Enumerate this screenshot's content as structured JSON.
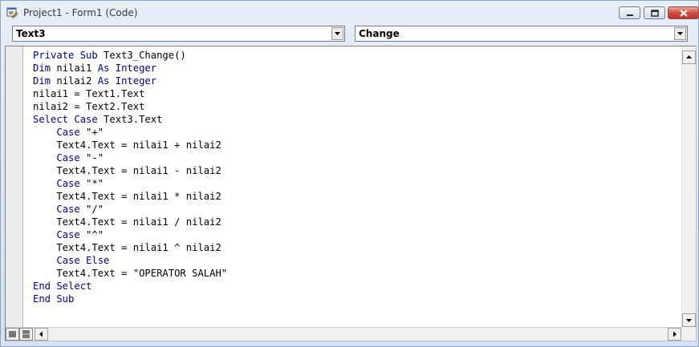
{
  "window": {
    "title": "Project1 - Form1 (Code)"
  },
  "object_combo": {
    "value": "Text3"
  },
  "procedure_combo": {
    "value": "Change"
  },
  "code_lines": [
    [
      [
        "kw",
        "Private Sub"
      ],
      [
        "t",
        " Text3_Change()"
      ]
    ],
    [
      [
        "kw",
        "Dim"
      ],
      [
        "t",
        " nilai1 "
      ],
      [
        "kw",
        "As Integer"
      ]
    ],
    [
      [
        "kw",
        "Dim"
      ],
      [
        "t",
        " nilai2 "
      ],
      [
        "kw",
        "As Integer"
      ]
    ],
    [
      [
        "t",
        "nilai1 = Text1.Text"
      ]
    ],
    [
      [
        "t",
        "nilai2 = Text2.Text"
      ]
    ],
    [
      [
        "kw",
        "Select Case"
      ],
      [
        "t",
        " Text3.Text"
      ]
    ],
    [
      [
        "t",
        "    "
      ],
      [
        "kw",
        "Case"
      ],
      [
        "t",
        " \"+\""
      ]
    ],
    [
      [
        "t",
        "    Text4.Text = nilai1 + nilai2"
      ]
    ],
    [
      [
        "t",
        "    "
      ],
      [
        "kw",
        "Case"
      ],
      [
        "t",
        " \"-\""
      ]
    ],
    [
      [
        "t",
        "    Text4.Text = nilai1 - nilai2"
      ]
    ],
    [
      [
        "t",
        "    "
      ],
      [
        "kw",
        "Case"
      ],
      [
        "t",
        " \"*\""
      ]
    ],
    [
      [
        "t",
        "    Text4.Text = nilai1 * nilai2"
      ]
    ],
    [
      [
        "t",
        "    "
      ],
      [
        "kw",
        "Case"
      ],
      [
        "t",
        " \"/\""
      ]
    ],
    [
      [
        "t",
        "    Text4.Text = nilai1 / nilai2"
      ]
    ],
    [
      [
        "t",
        "    "
      ],
      [
        "kw",
        "Case"
      ],
      [
        "t",
        " \"^\""
      ]
    ],
    [
      [
        "t",
        "    Text4.Text = nilai1 ^ nilai2"
      ]
    ],
    [
      [
        "t",
        "    "
      ],
      [
        "kw",
        "Case Else"
      ]
    ],
    [
      [
        "t",
        "    Text4.Text = \"OPERATOR SALAH\""
      ]
    ],
    [
      [
        "kw",
        "End Select"
      ]
    ],
    [
      [
        "kw",
        "End Sub"
      ]
    ]
  ],
  "colors": {
    "keyword": "#00008b",
    "text": "#000000",
    "titlebar": "#dfe9f5"
  },
  "icons": {
    "app": "vb-code-window-icon",
    "minimize": "minimize-icon",
    "maximize": "maximize-icon",
    "close": "close-icon",
    "dropdown": "chevron-down-icon",
    "scroll_up": "arrow-up-icon",
    "scroll_down": "arrow-down-icon",
    "scroll_left": "arrow-left-icon",
    "scroll_right": "arrow-right-icon",
    "procedure_view": "procedure-view-icon",
    "full_module_view": "full-module-view-icon"
  }
}
